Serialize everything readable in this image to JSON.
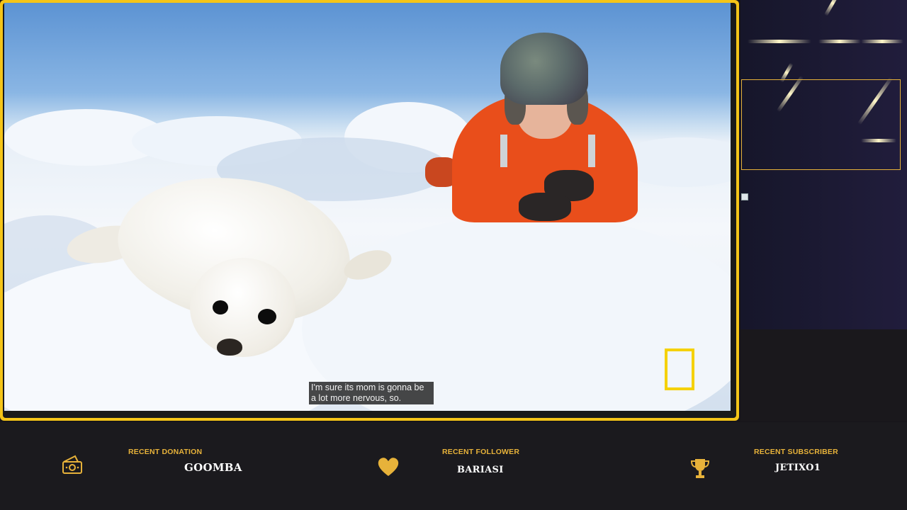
{
  "video": {
    "subtitle_lines": [
      "I'm sure its mom is gonna be",
      "a lot more nervous, so."
    ]
  },
  "alerts": {
    "donation": {
      "label": "RECENT DONATION",
      "value": "GOOMBA",
      "icon": "money-icon"
    },
    "follower": {
      "label": "RECENT FOLLOWER",
      "value": "BARIASI",
      "icon": "heart-icon"
    },
    "subscriber": {
      "label": "RECENT SUBSCRIBER",
      "value": "JETIXO1",
      "icon": "trophy-icon"
    }
  },
  "colors": {
    "accent": "#e7b23a",
    "frame": "#f5c518",
    "background": "#1b1a1e"
  }
}
